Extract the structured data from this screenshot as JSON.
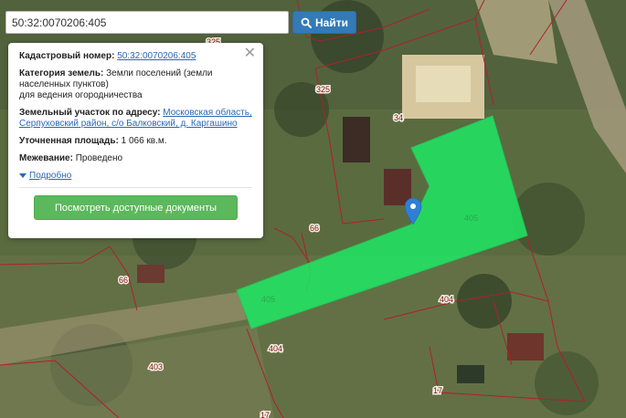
{
  "search": {
    "value": "50:32:0070206:405",
    "button_label": "Найти"
  },
  "popup": {
    "cadastral_label": "Кадастровый номер:",
    "cadastral_value": "50:32:0070206:405",
    "category_label": "Категория земель:",
    "category_value": "Земли поселений (земли населенных пунктов)",
    "category_extra": "для ведения огородничества",
    "address_label": "Земельный участок по адресу:",
    "address_value": "Московская область, Серпуховский район, с/о Балковский, д. Каргашино",
    "area_label": "Уточненная площадь:",
    "area_value": "1 066 кв.м.",
    "survey_label": "Межевание:",
    "survey_value": "Проведено",
    "details_link": "Подробно",
    "docs_button": "Посмотреть доступные документы"
  },
  "map": {
    "plot_labels": [
      "325",
      "325",
      "34",
      "66",
      "66",
      "404",
      "404",
      "403",
      "17",
      "17"
    ],
    "parcel_labels": [
      "405",
      "405"
    ]
  },
  "colors": {
    "parcel_fill": "#1fe864",
    "boundary": "#b0202a",
    "marker": "#2f7fd6",
    "search_button": "#337ab7",
    "docs_button": "#5cb85c"
  }
}
